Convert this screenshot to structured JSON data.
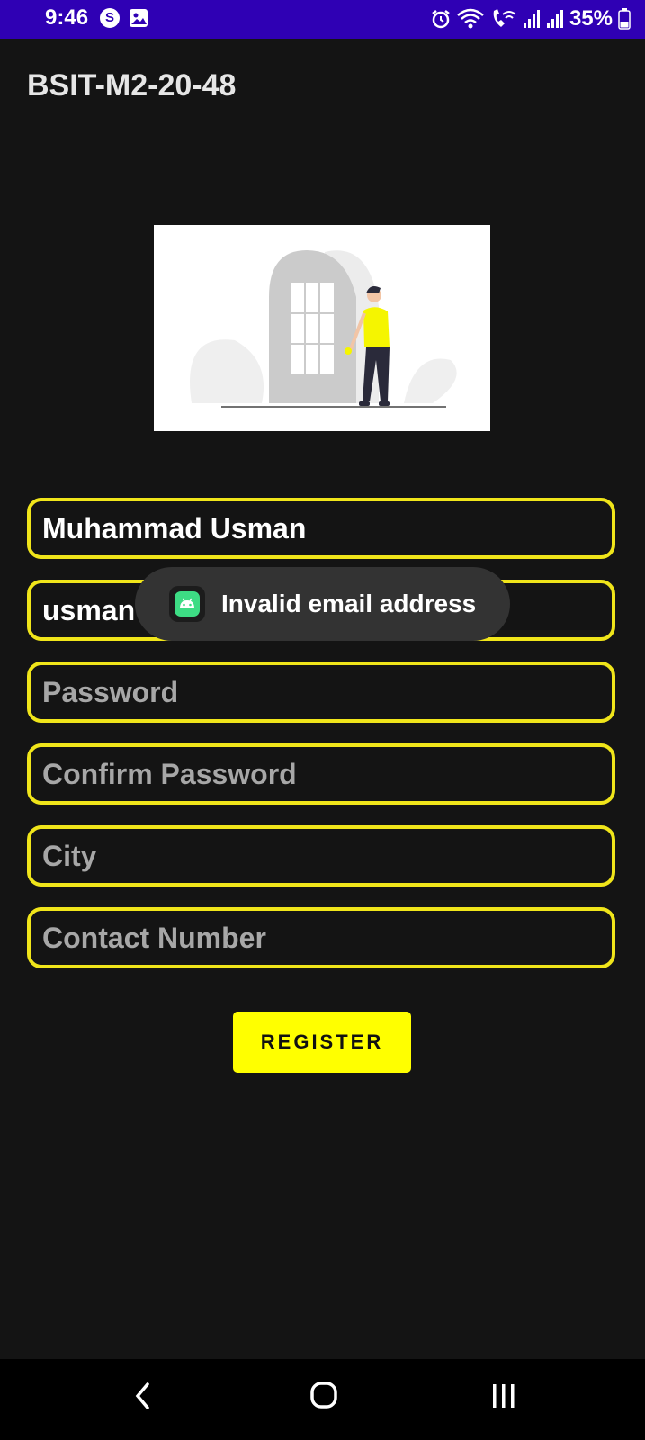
{
  "status_bar": {
    "time": "9:46",
    "battery": "35%",
    "icons": [
      "s-app-icon",
      "gallery-icon",
      "alarm-icon",
      "wifi-icon",
      "wifi-calling-icon",
      "signal-icon",
      "signal-icon",
      "battery-icon"
    ]
  },
  "app": {
    "title": "BSIT-M2-20-48",
    "accent_color": "#ffff00",
    "border_color": "#f0e51a"
  },
  "form": {
    "name_value": "Muhammad Usman",
    "email_value": "usman",
    "password_placeholder": "Password",
    "confirm_password_placeholder": "Confirm Password",
    "city_placeholder": "City",
    "contact_placeholder": "Contact Number",
    "register_label": "REGISTER"
  },
  "toast": {
    "message": "Invalid email address",
    "icon": "android-icon"
  },
  "nav_bar": {
    "icons": [
      "back-icon",
      "home-icon",
      "recents-icon"
    ]
  }
}
